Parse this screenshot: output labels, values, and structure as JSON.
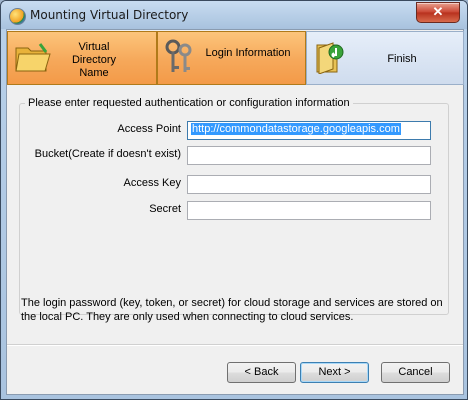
{
  "window": {
    "title": "Mounting Virtual Directory",
    "close_glyph": "✕"
  },
  "steps": [
    {
      "label": "Virtual Directory Name",
      "icon": "folder-open-icon",
      "state": "active"
    },
    {
      "label": "Login Information",
      "icon": "keys-icon",
      "state": "active"
    },
    {
      "label": "Finish",
      "icon": "finish-folder-icon",
      "state": "inactive"
    }
  ],
  "form": {
    "legend": "Please enter requested authentication or configuration information",
    "fields": [
      {
        "label": "Access Point",
        "value": "http://commondatastorage.googleapis.com"
      },
      {
        "label": "Bucket(Create if doesn't exist)",
        "value": ""
      },
      {
        "label": "Access Key",
        "value": ""
      },
      {
        "label": "Secret",
        "value": ""
      }
    ]
  },
  "note": "The login password (key, token, or secret) for cloud storage and services are stored on the local PC. They are only used when connecting to cloud services.",
  "buttons": {
    "back": "< Back",
    "next": "Next >",
    "cancel": "Cancel"
  },
  "colors": {
    "active_step": "#f6a85a",
    "inactive_step": "#dbe6f4",
    "selection": "#3399ff"
  }
}
